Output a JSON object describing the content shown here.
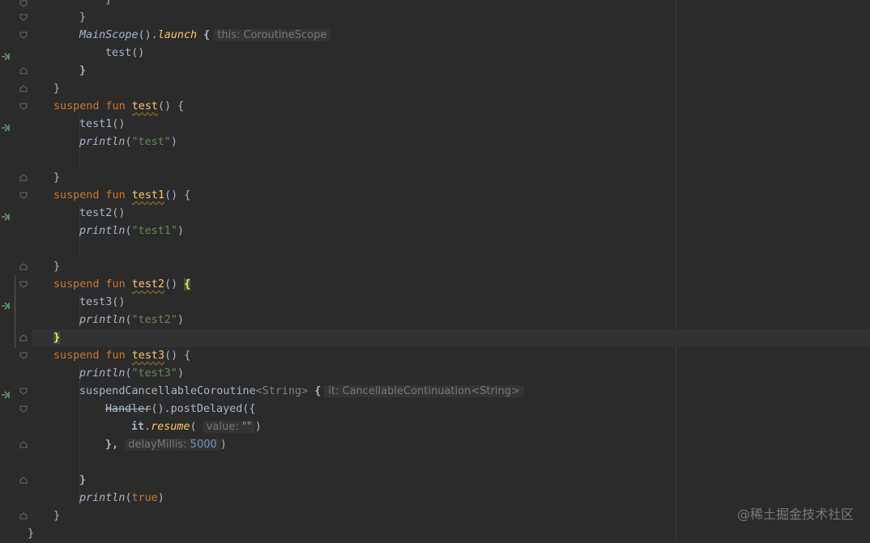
{
  "code": {
    "l0": "}",
    "l1": "}",
    "l2_a": "MainScope",
    "l2_b": "().",
    "l2_c": "launch",
    "l2_d": " {",
    "l2_hint": "this: CoroutineScope",
    "l3": "test()",
    "l4": "}",
    "l5": "}",
    "kw_suspend": "suspend",
    "kw_fun": "fun",
    "f_test": "test",
    "f_test1": "test1",
    "f_test2": "test2",
    "f_test3": "test3",
    "sig_tail": "() {",
    "sig_paren": "() ",
    "brace_open": "{",
    "brace_close": "}",
    "call_test1": "test1()",
    "call_test2": "test2()",
    "call_test3": "test3()",
    "println": "println",
    "s_test": "\"test\"",
    "s_test1": "\"test1\"",
    "s_test2": "\"test2\"",
    "s_test3": "\"test3\"",
    "suspend_cc": "suspendCancellableCoroutine",
    "type_arg": "<String>",
    "hint_it": "it: CancellableContinuation<String>",
    "handler": "Handler",
    "post_delayed": "().postDelayed({",
    "it": "it",
    "resume": "resume",
    "hint_value": "value:",
    "s_empty": "\"\"",
    "close_paren": ")",
    "brace_comma": "},",
    "hint_delay": "delayMillis:",
    "delay_value": "5000",
    "true_kw": "true",
    "final_brace": "}"
  },
  "watermark": "@稀土掘金技术社区"
}
